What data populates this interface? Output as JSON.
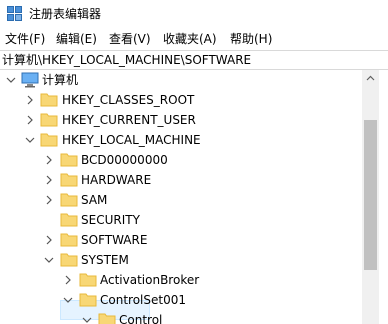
{
  "window": {
    "title": "注册表编辑器"
  },
  "menu": {
    "file": "文件(F)",
    "edit": "编辑(E)",
    "view": "查看(V)",
    "favorites": "收藏夹(A)",
    "help": "帮助(H)"
  },
  "address": {
    "path": "计算机\\HKEY_LOCAL_MACHINE\\SOFTWARE"
  },
  "tree": {
    "computer": "计算机",
    "hkcr": "HKEY_CLASSES_ROOT",
    "hkcu": "HKEY_CURRENT_USER",
    "hklm": "HKEY_LOCAL_MACHINE",
    "bcd": "BCD00000000",
    "hardware": "HARDWARE",
    "sam": "SAM",
    "security": "SECURITY",
    "software": "SOFTWARE",
    "system": "SYSTEM",
    "activation": "ActivationBroker",
    "controlset": "ControlSet001",
    "control": "Control"
  },
  "colors": {
    "folder": "#f8d775",
    "folder_dark": "#e8b93a",
    "selection": "#e5f3ff"
  },
  "icons": [
    "registry-editor-icon",
    "computer-icon",
    "folder-icon",
    "chevron-right-icon",
    "chevron-down-icon"
  ]
}
